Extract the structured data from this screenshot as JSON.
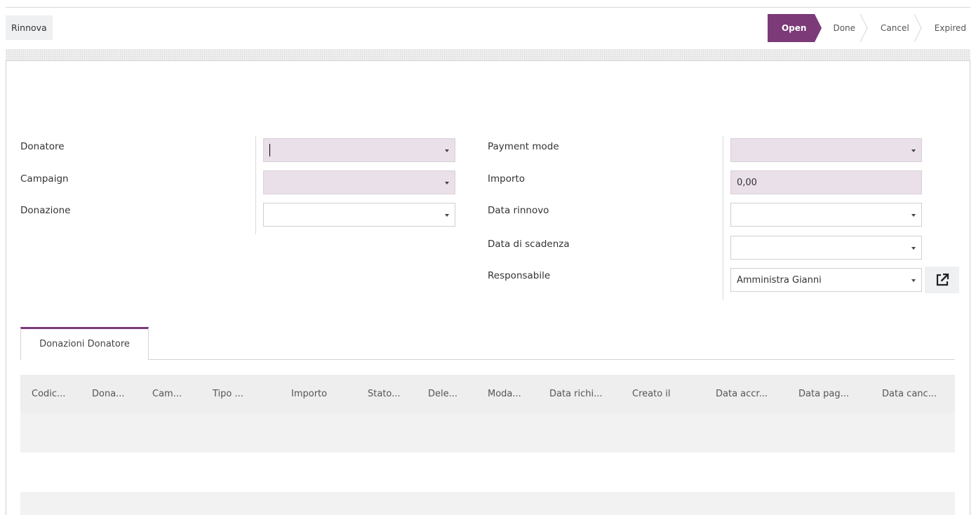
{
  "header": {
    "renew_button_label": "Rinnova"
  },
  "statusbar": {
    "stages": [
      {
        "label": "Open",
        "active": true
      },
      {
        "label": "Done",
        "active": false
      },
      {
        "label": "Cancel",
        "active": false
      },
      {
        "label": "Expired",
        "active": false
      }
    ]
  },
  "form": {
    "left": {
      "donatore": {
        "label": "Donatore",
        "value": ""
      },
      "campaign": {
        "label": "Campaign",
        "value": ""
      },
      "donazione": {
        "label": "Donazione",
        "value": ""
      }
    },
    "right": {
      "payment_mode": {
        "label": "Payment mode",
        "value": ""
      },
      "importo": {
        "label": "Importo",
        "value": "0,00"
      },
      "data_rinnovo": {
        "label": "Data rinnovo",
        "value": ""
      },
      "data_scadenza": {
        "label": "Data di scadenza",
        "value": ""
      },
      "responsabile": {
        "label": "Responsabile",
        "value": "Amministra Gianni"
      }
    }
  },
  "tabs": [
    {
      "label": "Donazioni Donatore",
      "active": true
    }
  ],
  "table": {
    "columns": [
      "Codic...",
      "Dona...",
      "Cam...",
      "Tipo ...",
      "Importo",
      "Stato...",
      "Dele...",
      "Moda...",
      "Data richi...",
      "Creato il",
      "Data accr...",
      "Data pag...",
      "Data canc..."
    ],
    "rows": []
  },
  "colors": {
    "accent": "#7c3a78",
    "required_field": "#e9e0e9",
    "table_header_bg": "#eeeeee"
  },
  "icons": {
    "external_link": "external-link-icon",
    "dropdown": "caret-down-icon"
  }
}
